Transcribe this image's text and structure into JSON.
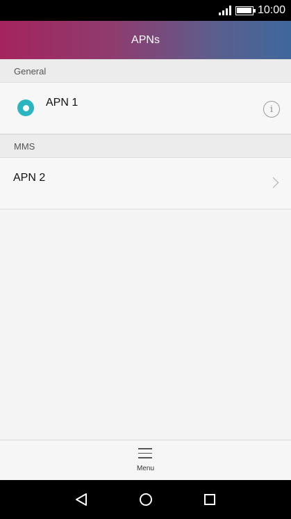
{
  "status_bar": {
    "time": "10:00",
    "signal_icon": "signal-bars-icon",
    "battery_icon": "battery-icon"
  },
  "header": {
    "title": "APNs",
    "gradient_colors": [
      "#a5245e",
      "#3f679c"
    ]
  },
  "sections": [
    {
      "title": "General",
      "items": [
        {
          "label": "APN 1",
          "selected": true,
          "leading_icon": "radio-selected-icon",
          "trailing_icon": "info-icon",
          "info_glyph": "i"
        }
      ]
    },
    {
      "title": "MMS",
      "items": [
        {
          "label": "APN 2",
          "trailing_icon": "chevron-right-icon"
        }
      ]
    }
  ],
  "bottom_menu": {
    "label": "Menu",
    "icon": "hamburger-menu-icon"
  },
  "nav_bar": {
    "buttons": [
      "back-icon",
      "home-icon",
      "recents-icon"
    ]
  },
  "colors": {
    "accent": "#2ab5c0",
    "background": "#f4f4f4"
  }
}
